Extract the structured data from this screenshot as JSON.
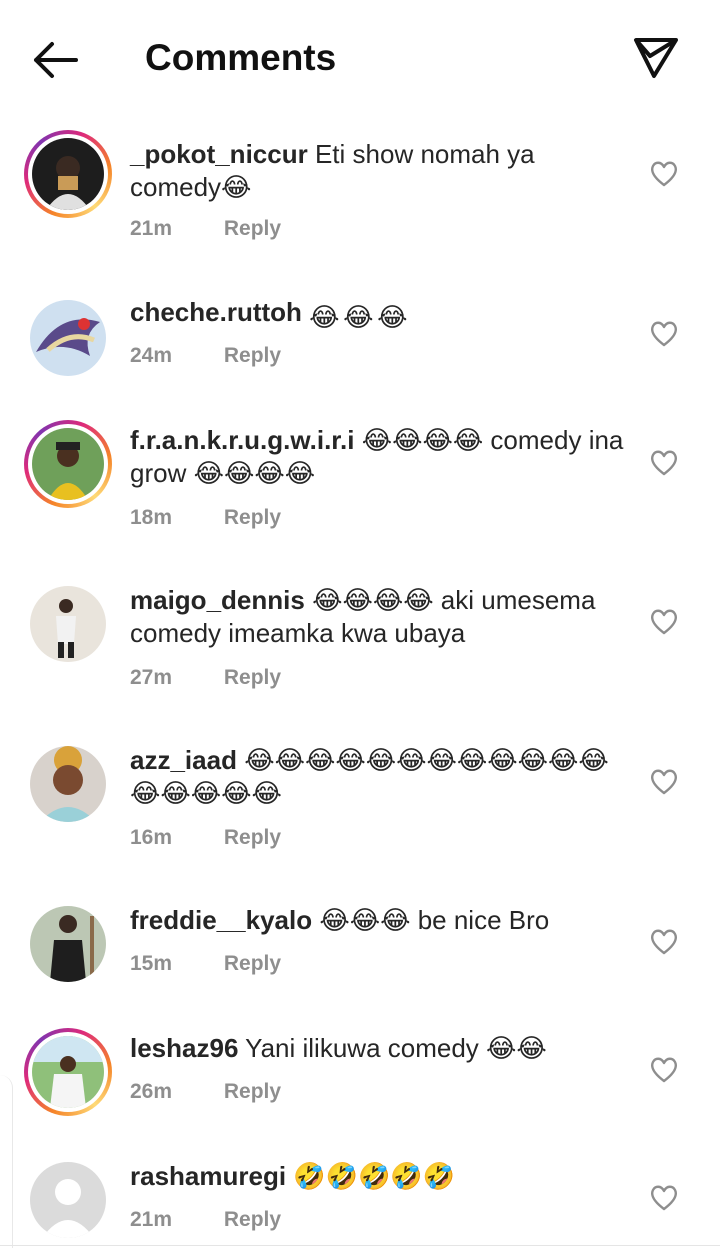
{
  "header": {
    "title": "Comments"
  },
  "comments": [
    {
      "username": "_pokot_niccur",
      "text": "Eti show nomah ya comedy",
      "emoji": "😂",
      "emoji_count": 1,
      "time": "21m",
      "reply_label": "Reply",
      "story_ring": true
    },
    {
      "username": "cheche.ruttoh",
      "text": "",
      "emoji": "😂",
      "emoji_count": 3,
      "time": "24m",
      "reply_label": "Reply",
      "story_ring": false
    },
    {
      "username": "f.r.a.n.k.r.u.g.w.i.r.i",
      "text": "😂😂😂😂 comedy ina grow 😂😂😂😂",
      "time": "18m",
      "reply_label": "Reply",
      "story_ring": true
    },
    {
      "username": "maigo_dennis",
      "text": "😂😂😂😂 aki umesema comedy imeamka kwa ubaya",
      "time": "27m",
      "reply_label": "Reply",
      "story_ring": false
    },
    {
      "username": "azz_iaad",
      "text": "😂😂😂😂😂😂😂😂😂😂😂😂😂😂😂😂😂",
      "time": "16m",
      "reply_label": "Reply",
      "story_ring": false
    },
    {
      "username": "freddie__kyalo",
      "text": "😂😂😂 be nice Bro",
      "time": "15m",
      "reply_label": "Reply",
      "story_ring": false
    },
    {
      "username": "leshaz96",
      "text": "Yani ilikuwa comedy 😂😂",
      "time": "26m",
      "reply_label": "Reply",
      "story_ring": true
    },
    {
      "username": "rashamuregi",
      "text": "🤣🤣🤣🤣🤣",
      "time": "21m",
      "reply_label": "Reply",
      "story_ring": false
    }
  ],
  "icons": {
    "back": "arrow-left-icon",
    "send": "paper-plane-icon",
    "like": "heart-outline-icon",
    "emoji_laugh": "face-with-tears-of-joy",
    "emoji_rofl": "rolling-on-the-floor-laughing"
  },
  "colors": {
    "ring_start": "#f58529",
    "ring_mid": "#dd2a7b",
    "meta": "#8e8e8e",
    "text": "#262626"
  }
}
